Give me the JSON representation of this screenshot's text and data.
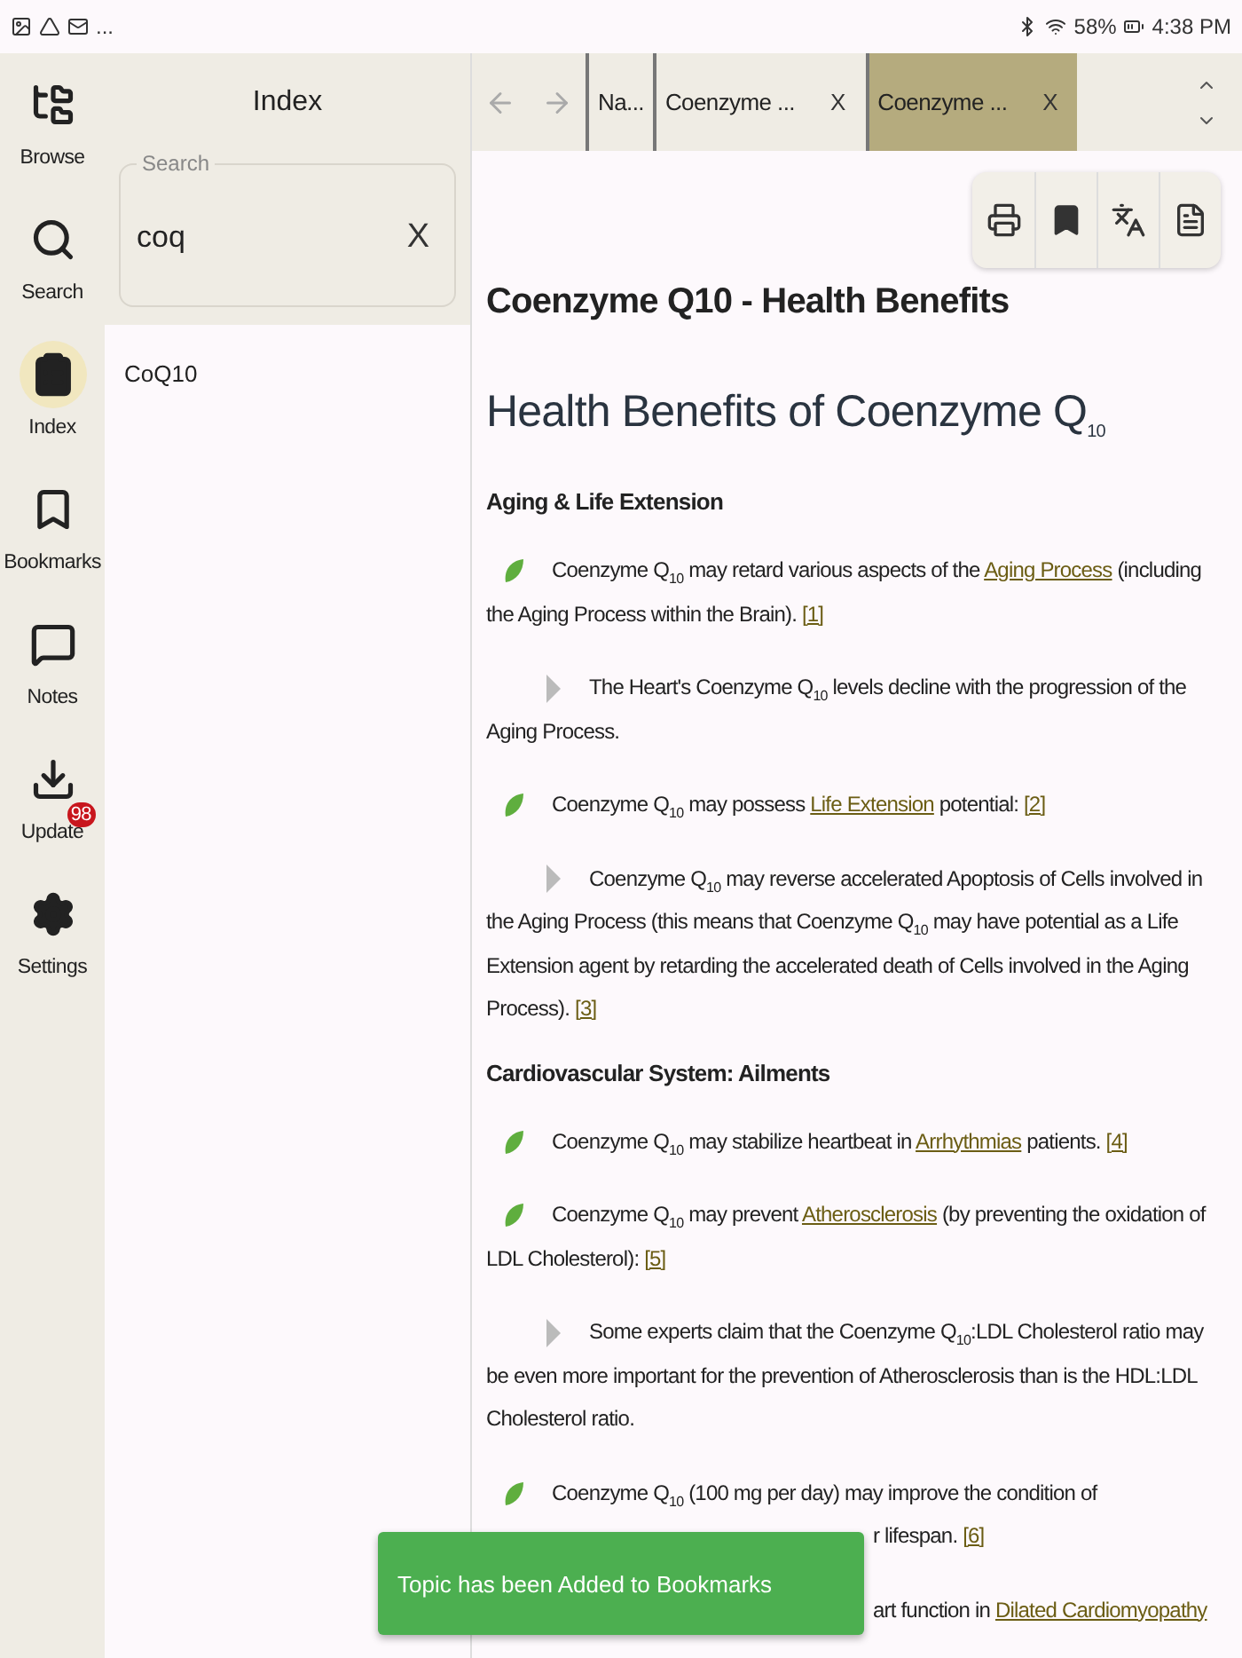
{
  "status_bar": {
    "more": "...",
    "battery": "58%",
    "time": "4:38 PM"
  },
  "nav": [
    {
      "label": "Browse",
      "selected": false
    },
    {
      "label": "Search",
      "selected": false
    },
    {
      "label": "Index",
      "selected": true
    },
    {
      "label": "Bookmarks",
      "selected": false
    },
    {
      "label": "Notes",
      "selected": false
    },
    {
      "label": "Update",
      "selected": false,
      "badge": "98"
    },
    {
      "label": "Settings",
      "selected": false
    }
  ],
  "index_panel": {
    "title": "Index",
    "search": {
      "label": "Search",
      "value": "coq",
      "clear": "X"
    },
    "results": [
      "CoQ10"
    ]
  },
  "tabs": [
    {
      "label": "Na...",
      "selected": false
    },
    {
      "label": "Coenzyme ...",
      "close": "X",
      "selected": false
    },
    {
      "label": "Coenzyme ...",
      "close": "X",
      "selected": true
    }
  ],
  "article": {
    "title": "Coenzyme Q10 - Health Benefits",
    "heading": "Health Benefits of Coenzyme Q$_{10}$",
    "blocks": [
      {
        "kind": "section",
        "text": "Aging & Life Extension"
      },
      {
        "kind": "leaf",
        "parts": [
          {
            "kind": "text",
            "text": "Coenzyme Q$_{10}$ may retard various aspects of the "
          },
          {
            "kind": "link",
            "text": "Aging Process"
          },
          {
            "kind": "text",
            "text": " (including the Aging Process within the Brain). "
          },
          {
            "kind": "ref",
            "text": "[1]"
          }
        ]
      },
      {
        "kind": "sub",
        "parts": [
          {
            "kind": "text",
            "text": "The Heart's Coenzyme Q$_{10}$ levels decline with the progression of the Aging Process."
          }
        ]
      },
      {
        "kind": "leaf",
        "parts": [
          {
            "kind": "text",
            "text": "Coenzyme Q$_{10}$ may possess "
          },
          {
            "kind": "link",
            "text": "Life Extension"
          },
          {
            "kind": "text",
            "text": " potential: "
          },
          {
            "kind": "ref",
            "text": "[2]"
          }
        ]
      },
      {
        "kind": "sub",
        "parts": [
          {
            "kind": "text",
            "text": "Coenzyme Q$_{10}$ may reverse accelerated Apoptosis of Cells involved in the Aging Process (this means that Coenzyme Q$_{10}$ may have potential as a Life Extension agent by retarding the accelerated death of Cells involved in the Aging Process). "
          },
          {
            "kind": "ref",
            "text": "[3]"
          }
        ]
      },
      {
        "kind": "section",
        "text": "Cardiovascular System:  Ailments"
      },
      {
        "kind": "leaf",
        "parts": [
          {
            "kind": "text",
            "text": "Coenzyme Q$_{10}$ may stabilize heartbeat in "
          },
          {
            "kind": "link",
            "text": "Arrhythmias"
          },
          {
            "kind": "text",
            "text": " patients. "
          },
          {
            "kind": "ref",
            "text": "[4]"
          }
        ]
      },
      {
        "kind": "leaf",
        "parts": [
          {
            "kind": "text",
            "text": "Coenzyme Q$_{10}$ may prevent "
          },
          {
            "kind": "link",
            "text": "Atherosclerosis"
          },
          {
            "kind": "text",
            "text": " (by preventing the oxidation of LDL Cholesterol): "
          },
          {
            "kind": "ref",
            "text": "[5]"
          }
        ]
      },
      {
        "kind": "sub",
        "parts": [
          {
            "kind": "text",
            "text": "Some experts claim that the Coenzyme Q$_{10}$:LDL Cholesterol ratio may be even more important for the prevention of Atherosclerosis than is the HDL:LDL Cholesterol ratio."
          }
        ]
      },
      {
        "kind": "leaf",
        "parts": [
          {
            "kind": "text",
            "text": "Coenzyme Q$_{10}$ (100 mg per day) may improve the condition of"
          }
        ]
      },
      {
        "kind": "cont",
        "parts": [
          {
            "kind": "text",
            "text": "r lifespan. "
          },
          {
            "kind": "ref",
            "text": "[6]"
          }
        ]
      },
      {
        "kind": "tail",
        "parts": [
          {
            "kind": "text",
            "text": "art function in "
          },
          {
            "kind": "link",
            "text": "Dilated Cardiomyopathy"
          }
        ]
      }
    ]
  },
  "toast": "Topic has been Added to Bookmarks"
}
